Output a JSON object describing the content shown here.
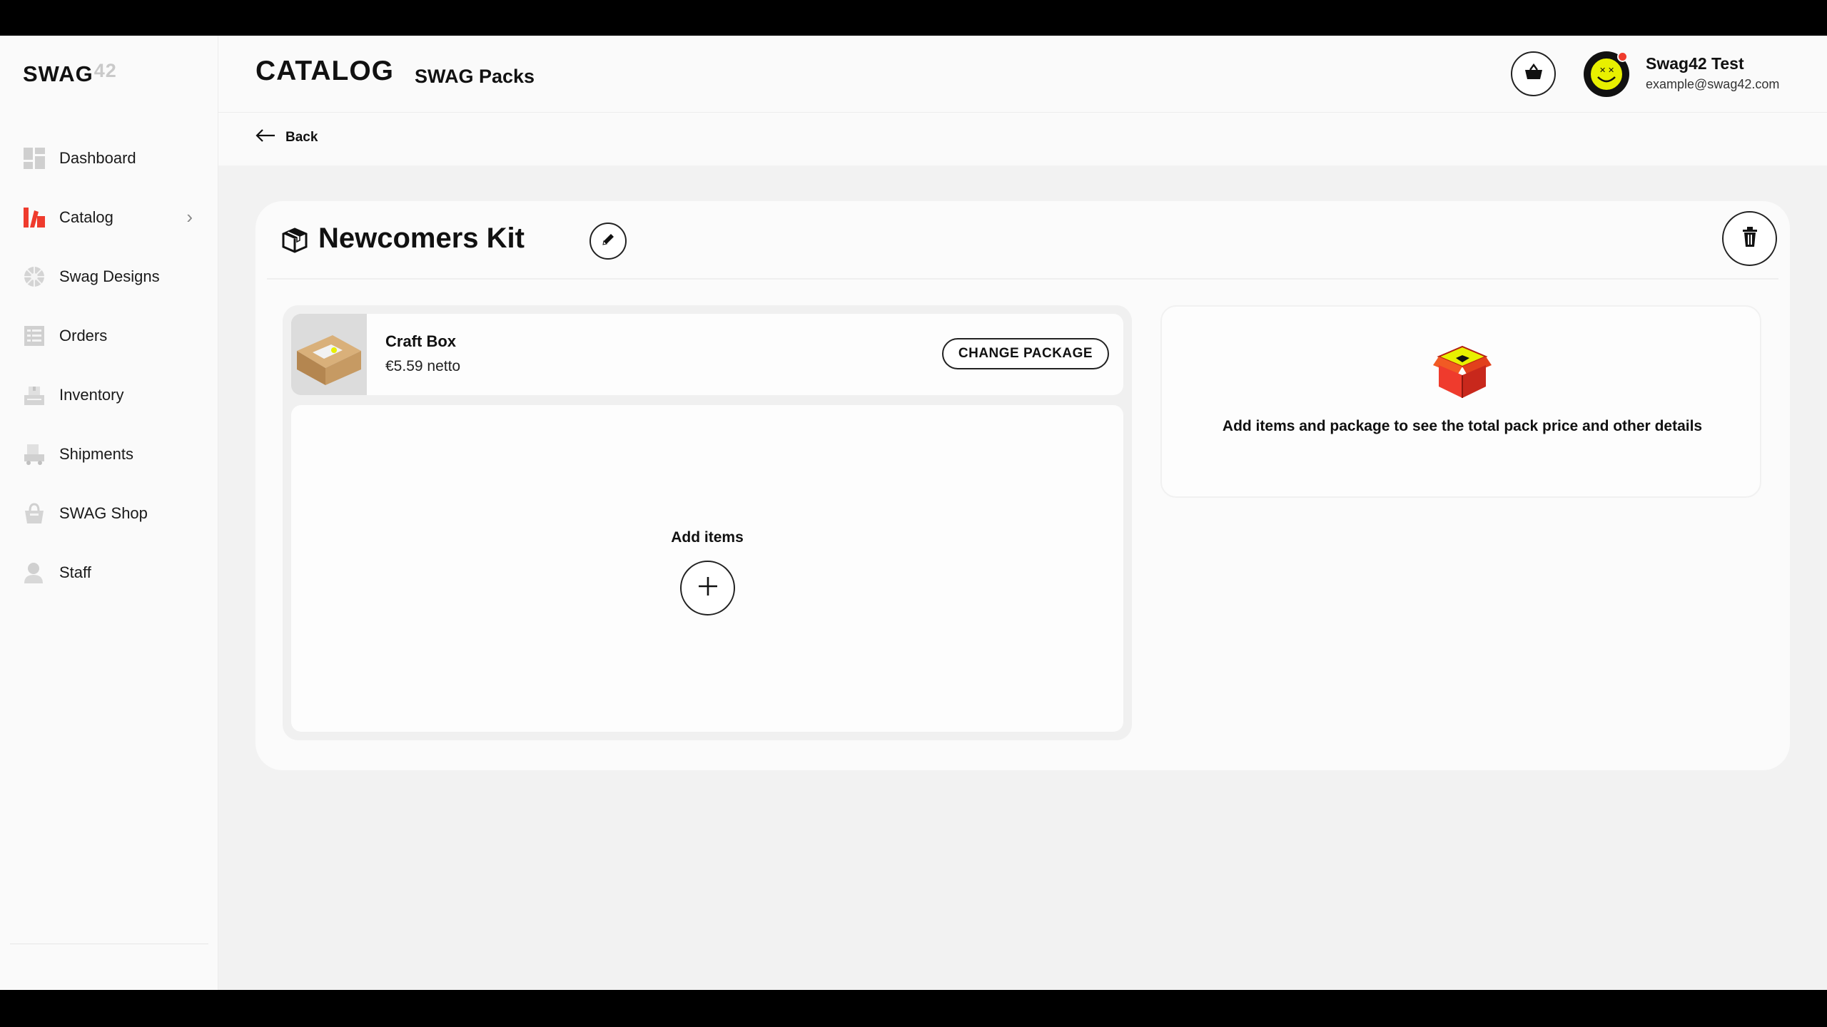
{
  "brand": {
    "logo_main": "SWAG",
    "logo_sup": "42"
  },
  "sidebar": {
    "items": [
      {
        "label": "Dashboard",
        "icon": "dashboard-icon"
      },
      {
        "label": "Catalog",
        "icon": "catalog-icon",
        "active": true,
        "has_chevron": true
      },
      {
        "label": "Swag Designs",
        "icon": "swag-designs-icon"
      },
      {
        "label": "Orders",
        "icon": "orders-icon"
      },
      {
        "label": "Inventory",
        "icon": "inventory-icon"
      },
      {
        "label": "Shipments",
        "icon": "shipments-icon"
      },
      {
        "label": "SWAG Shop",
        "icon": "shop-icon"
      },
      {
        "label": "Staff",
        "icon": "staff-icon"
      }
    ]
  },
  "header": {
    "title": "CATALOG",
    "subtitle": "SWAG Packs",
    "cart_icon": "basket-icon",
    "user": {
      "name": "Swag42 Test",
      "email": "example@swag42.com",
      "has_notification": true
    }
  },
  "back": {
    "label": "Back"
  },
  "kit": {
    "title": "Newcomers Kit",
    "package": {
      "name": "Craft Box",
      "price": "€5.59 netto",
      "change_label": "CHANGE PACKAGE"
    },
    "items": {
      "add_label": "Add items"
    },
    "summary": {
      "empty_text": "Add items and package to see the total pack price and other details"
    }
  },
  "colors": {
    "accent": "#ef3b2d",
    "highlight": "#e8f000",
    "text": "#111111",
    "background": "#f2f2f2"
  }
}
